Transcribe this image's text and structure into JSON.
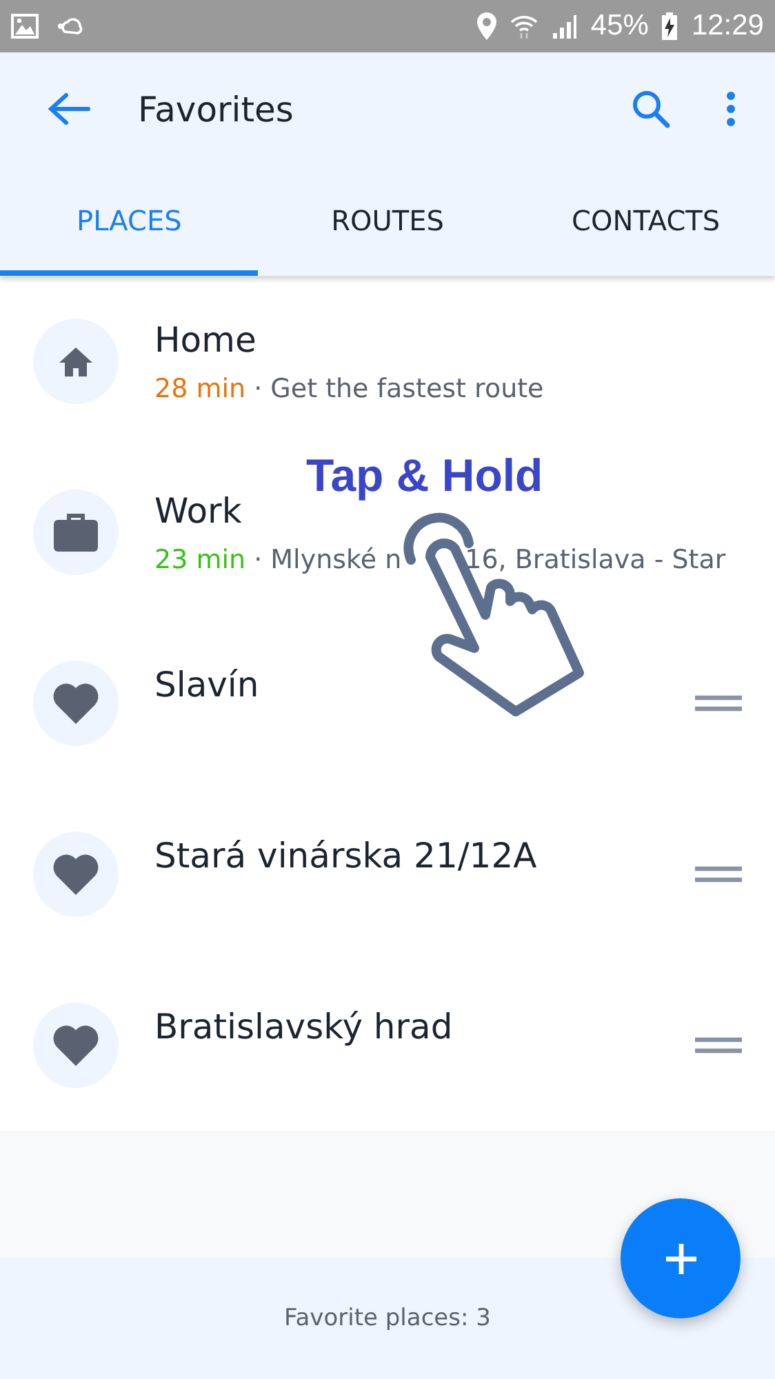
{
  "status_bar": {
    "battery": "45%",
    "time": "12:29"
  },
  "header": {
    "title": "Favorites"
  },
  "tabs": [
    {
      "label": "PLACES",
      "selected": true
    },
    {
      "label": "ROUTES",
      "selected": false
    },
    {
      "label": "CONTACTS",
      "selected": false
    }
  ],
  "places": [
    {
      "kind": "home",
      "title": "Home",
      "time": "28 min",
      "color": "#e8740c",
      "subtitle": [
        "· Get the fastest route"
      ]
    },
    {
      "kind": "work",
      "title": "Work",
      "time": "23 min",
      "color": "#3cbf1c",
      "subtitle": [
        "· Mlynské n",
        "16, Bratislava - Star"
      ]
    },
    {
      "kind": "favorite",
      "title": "Slavín"
    },
    {
      "kind": "favorite",
      "title": "Stará vinárska 21/12A"
    },
    {
      "kind": "favorite",
      "title": "Bratislavský hrad"
    }
  ],
  "overlay": {
    "text": "Tap & Hold"
  },
  "footer": {
    "text": "Favorite places: 3"
  }
}
